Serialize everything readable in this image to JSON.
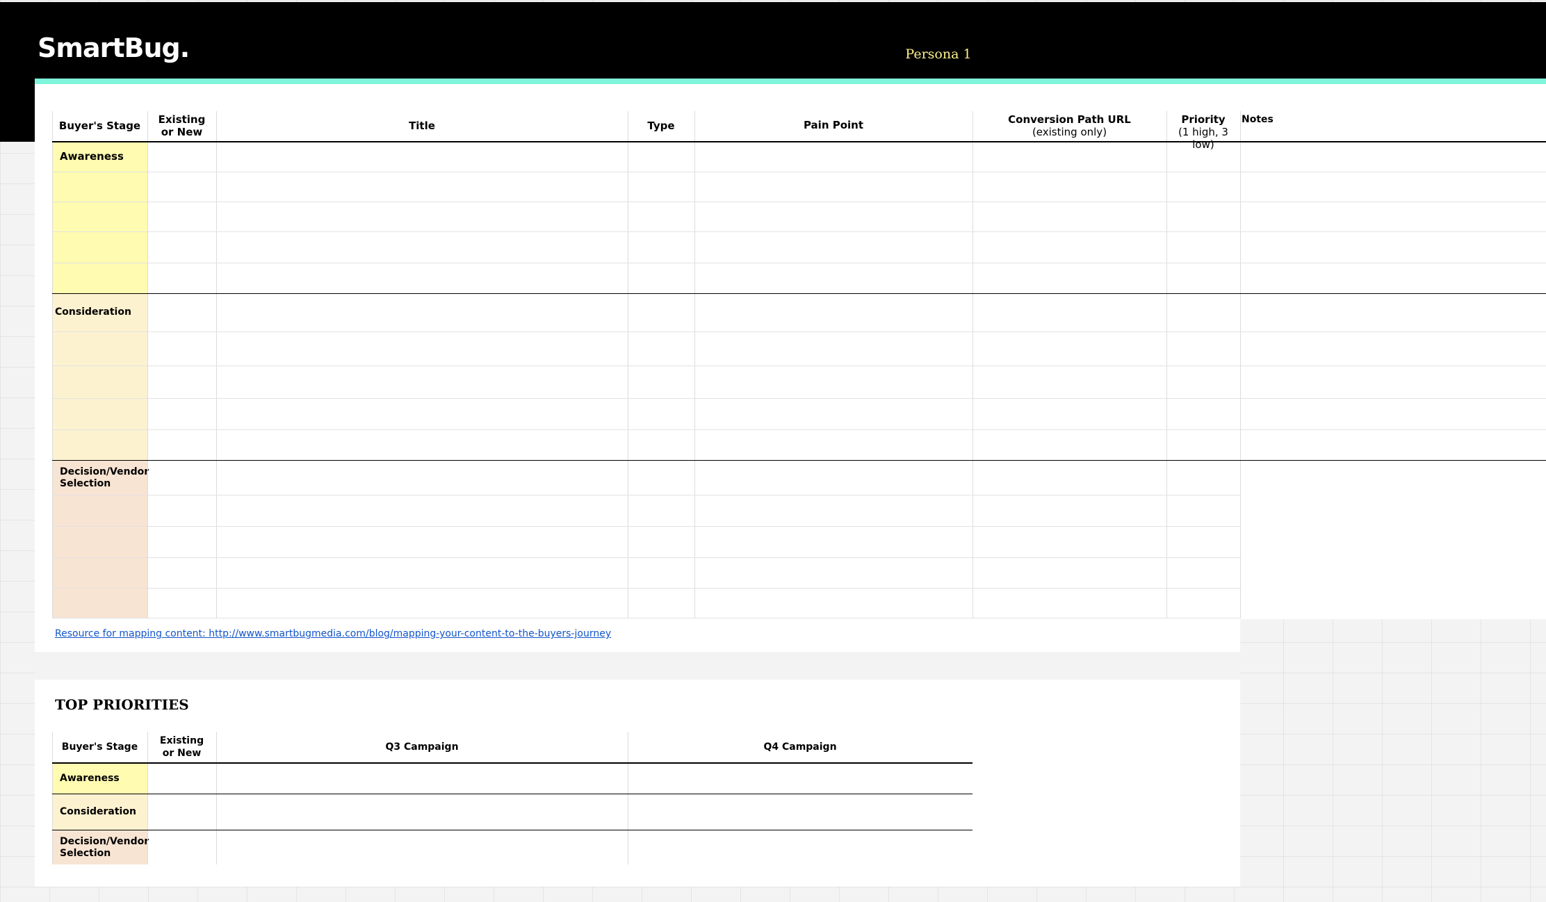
{
  "header": {
    "logo_text": "SmartBug.",
    "persona": "Persona 1"
  },
  "colors": {
    "header_bg": "#000000",
    "persona_text": "#fff38a",
    "teal_bar": "#7ff5dc",
    "awareness": "#fffbb0",
    "consideration": "#fdf2d0",
    "decision": "#f8e4d3",
    "link": "#1155cc"
  },
  "main_table": {
    "columns": [
      {
        "line1": "Buyer's Stage",
        "line2": ""
      },
      {
        "line1": "Existing",
        "line2": "or New"
      },
      {
        "line1": "Title",
        "line2": ""
      },
      {
        "line1": "Type",
        "line2": ""
      },
      {
        "line1": "Pain Point",
        "line2": ""
      },
      {
        "line1": "Conversion Path URL",
        "line2": "(existing only)"
      },
      {
        "line1": "Priority",
        "line2": "(1 high, 3 low)"
      },
      {
        "line1": "Notes",
        "line2": ""
      }
    ],
    "stages": [
      {
        "line1": "Awareness",
        "line2": ""
      },
      {
        "line1": "Consideration",
        "line2": ""
      },
      {
        "line1": "Decision/Vendor",
        "line2": "Selection"
      }
    ]
  },
  "resource_link": "Resource for mapping content: http://www.smartbugmedia.com/blog/mapping-your-content-to-the-buyers-journey",
  "top_priorities": {
    "title": "TOP PRIORITIES",
    "columns": [
      {
        "line1": "Buyer's Stage",
        "line2": ""
      },
      {
        "line1": "Existing",
        "line2": "or New"
      },
      {
        "line1": "Q3 Campaign",
        "line2": ""
      },
      {
        "line1": "Q4 Campaign",
        "line2": ""
      }
    ],
    "stages": [
      {
        "line1": "Awareness",
        "line2": ""
      },
      {
        "line1": "Consideration",
        "line2": ""
      },
      {
        "line1": "Decision/Vendor",
        "line2": "Selection"
      }
    ]
  }
}
